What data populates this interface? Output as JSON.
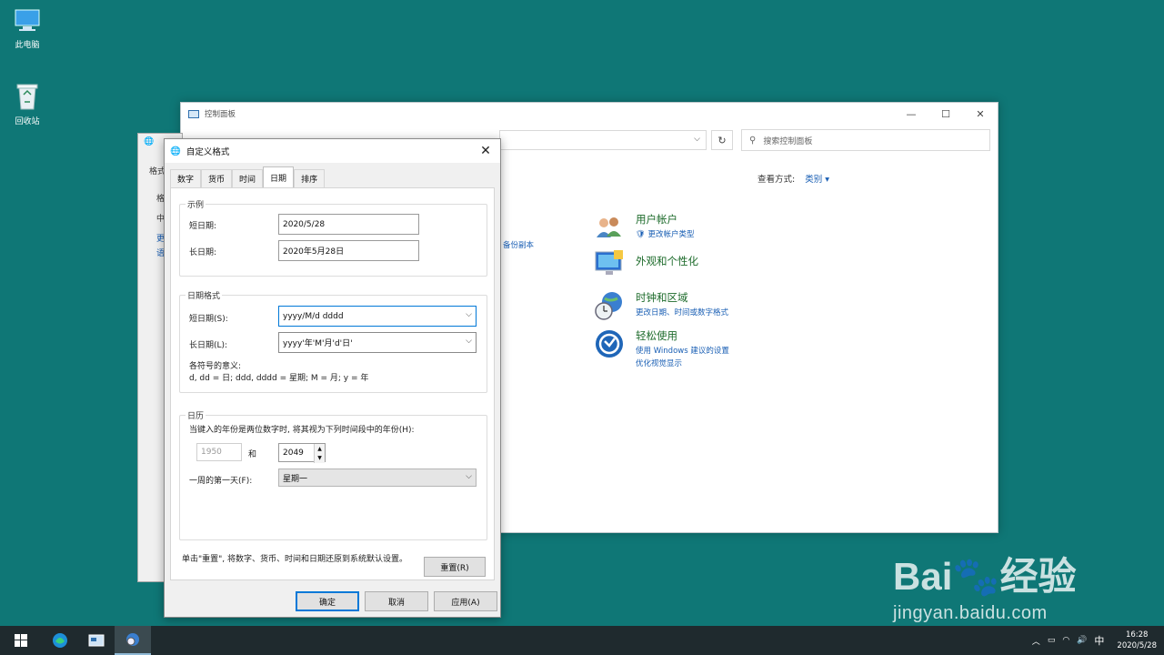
{
  "desktop": {
    "icons": [
      {
        "label": "此电脑",
        "icon": "computer-icon"
      },
      {
        "label": "回收站",
        "icon": "recycle-bin-icon"
      }
    ]
  },
  "control_panel": {
    "title": "控制面板",
    "search_placeholder": "搜索控制面板",
    "view_by_label": "查看方式:",
    "view_by_value": "类别 ▾",
    "backup_fragment": "备份副本",
    "categories": [
      {
        "title": "用户帐户",
        "links": [
          "更改帐户类型"
        ],
        "icon": "user-accounts-icon"
      },
      {
        "title": "外观和个性化",
        "links": [],
        "icon": "appearance-icon"
      },
      {
        "title": "时钟和区域",
        "links": [
          "更改日期、时间或数字格式"
        ],
        "icon": "clock-region-icon"
      },
      {
        "title": "轻松使用",
        "links": [
          "使用 Windows 建议的设置",
          "优化视觉显示"
        ],
        "icon": "ease-of-access-icon"
      }
    ]
  },
  "region_window": {
    "fragments": [
      "格式",
      "格",
      "中",
      "更",
      "语"
    ]
  },
  "dialog": {
    "title": "自定义格式",
    "tabs": [
      "数字",
      "货币",
      "时间",
      "日期",
      "排序"
    ],
    "active_tab": "日期",
    "example_group": "示例",
    "short_date_label": "短日期:",
    "short_date_value": "2020/5/28",
    "long_date_label": "长日期:",
    "long_date_value": "2020年5月28日",
    "format_group": "日期格式",
    "short_format_label": "短日期(S):",
    "short_format_value": "yyyy/M/d dddd",
    "long_format_label": "长日期(L):",
    "long_format_value": "yyyy'年'M'月'd'日'",
    "symbols_title": "各符号的意义:",
    "symbols_text": "d, dd = 日;  ddd, dddd = 星期;  M = 月;  y = 年",
    "calendar_group": "日历",
    "two_digit_text": "当键入的年份是两位数字时, 将其视为下列时间段中的年份(H):",
    "year_from": "1950",
    "year_and": "和",
    "year_to": "2049",
    "first_day_label": "一周的第一天(F):",
    "first_day_value": "星期一",
    "reset_note": "单击\"重置\", 将数字、货币、时间和日期还原到系统默认设置。",
    "reset_button": "重置(R)",
    "ok_button": "确定",
    "cancel_button": "取消",
    "apply_button": "应用(A)"
  },
  "taskbar": {
    "ime": "中",
    "time": "16:28",
    "date": "2020/5/28"
  },
  "watermark": {
    "brand": "Bai🐾经验",
    "url": "jingyan.baidu.com"
  },
  "colors": {
    "desktop": "#0f7776",
    "accent": "#0078d7",
    "category_title": "#1d6b2b",
    "link": "#1a5fb4"
  }
}
